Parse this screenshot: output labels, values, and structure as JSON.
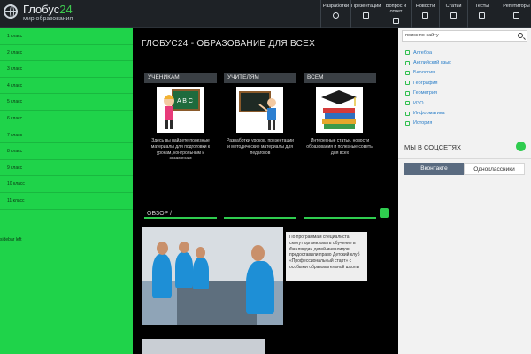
{
  "header": {
    "brand": "Глобус",
    "brand_num": "24",
    "subtitle": "мир образования",
    "nav": [
      {
        "label": "Разработки",
        "icon": "gear-icon"
      },
      {
        "label": "Презентации",
        "icon": "film-icon"
      },
      {
        "label": "Вопрос и ответ",
        "icon": "question-icon"
      },
      {
        "label": "Новости",
        "icon": "news-icon"
      },
      {
        "label": "Статьи",
        "icon": "article-icon"
      },
      {
        "label": "Тесты",
        "icon": "check-icon"
      },
      {
        "label": "Репетиторы",
        "icon": "tutor-icon"
      }
    ]
  },
  "sidebar": {
    "items": [
      "1 класс",
      "2 класс",
      "3 класс",
      "4 класс",
      "5 класс",
      "6 класс",
      "7 класс",
      "8 класс",
      "9 класс",
      "10 класс",
      "11 класс"
    ],
    "footer_label": "sidebar left"
  },
  "main": {
    "title": "ГЛОБУС24 - ОБРАЗОВАНИЕ ДЛЯ ВСЕХ",
    "categories": [
      {
        "label": "УЧЕНИКАМ",
        "text": "Здесь вы найдете полезные материалы для подготовки к урокам, контрольным и экзаменам"
      },
      {
        "label": "УЧИТЕЛЯМ",
        "text": "Разработки уроков, презентации и методические материалы для педагогов"
      },
      {
        "label": "ВСЕМ",
        "text": "Интересные статьи, новости образования и полезные советы для всех"
      }
    ],
    "news_title": "ОБЗОР /",
    "news_text": "По программам специалиста смогут организовать обучение в Финляндии детей-инвалидов предоставили право Детский клуб «Профессиональный старт» с особыми образовательной школы"
  },
  "right": {
    "search_placeholder": "поиск по сайту",
    "subjects": [
      "Алгебра",
      "Английский язык",
      "Биология",
      "География",
      "Геометрия",
      "ИЗО",
      "Информатика",
      "История"
    ],
    "social_title": "МЫ В СОЦСЕТЯХ",
    "social_tabs": [
      "Вконтакте",
      "Одноклассники"
    ]
  },
  "colors": {
    "accent": "#1fd34a",
    "header": "#1e2226",
    "main_bg": "#000000"
  }
}
